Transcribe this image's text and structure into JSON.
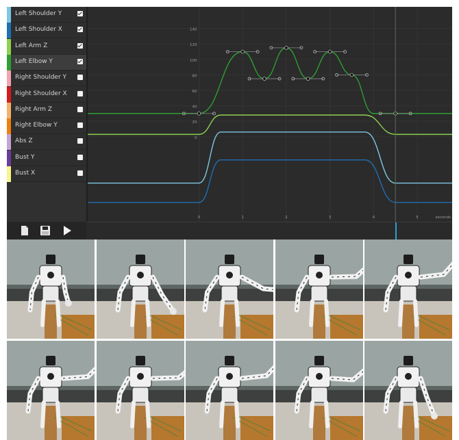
{
  "tracks": [
    {
      "label": "Left Shoulder Y",
      "color": "#7ec8e3",
      "checked": true,
      "selected": false
    },
    {
      "label": "Left Shoulder X",
      "color": "#1f6fb5",
      "checked": true,
      "selected": false
    },
    {
      "label": "Left Arm Z",
      "color": "#8fd14f",
      "checked": true,
      "selected": false
    },
    {
      "label": "Left Elbow Y",
      "color": "#2f9e33",
      "checked": true,
      "selected": true
    },
    {
      "label": "Right Shoulder Y",
      "color": "#f4a3b0",
      "checked": false,
      "selected": false
    },
    {
      "label": "Right Shoulder X",
      "color": "#d7191c",
      "checked": false,
      "selected": false
    },
    {
      "label": "Right Arm Z",
      "color": "#f4b26b",
      "checked": false,
      "selected": false
    },
    {
      "label": "Right Elbow Y",
      "color": "#f07f0f",
      "checked": false,
      "selected": false
    },
    {
      "label": "Abs Z",
      "color": "#c2a5d6",
      "checked": false,
      "selected": false
    },
    {
      "label": "Bust Y",
      "color": "#6a3d9a",
      "checked": false,
      "selected": false
    },
    {
      "label": "Bust X",
      "color": "#f7f58c",
      "checked": false,
      "selected": false
    }
  ],
  "toolbar": {
    "new_icon": "document-icon",
    "save_icon": "save-disk-icon",
    "play_icon": "play-icon"
  },
  "chart_data": {
    "type": "line",
    "xlabel": "seconds",
    "x_ticks": [
      0,
      1,
      2,
      3,
      4,
      5
    ],
    "y_ticks": [
      0,
      20,
      40,
      60,
      80,
      100,
      120,
      140
    ],
    "xlim": [
      -2.55,
      5.8
    ],
    "ylim": [
      -110,
      168
    ],
    "cursor_x": 4.5,
    "series": [
      {
        "color": "#2f9e33",
        "points": [
          [
            -2.55,
            30
          ],
          [
            0,
            30
          ],
          [
            1,
            110
          ],
          [
            1.5,
            75
          ],
          [
            2,
            115
          ],
          [
            2.5,
            75
          ],
          [
            3,
            110
          ],
          [
            3.5,
            80
          ],
          [
            4,
            30
          ],
          [
            4.5,
            30
          ],
          [
            5.8,
            30
          ]
        ],
        "keyframes": [
          [
            0,
            30
          ],
          [
            1,
            110
          ],
          [
            1.5,
            75
          ],
          [
            2,
            115
          ],
          [
            2.5,
            75
          ],
          [
            3,
            110
          ],
          [
            3.5,
            80
          ],
          [
            4.5,
            30
          ]
        ]
      },
      {
        "color": "#8fd14f",
        "points": [
          [
            -2.55,
            3
          ],
          [
            0,
            3
          ],
          [
            0.5,
            28
          ],
          [
            3.8,
            28
          ],
          [
            4.5,
            3
          ],
          [
            5.8,
            3
          ]
        ]
      },
      {
        "color": "#7ec8e3",
        "points": [
          [
            -2.55,
            -60
          ],
          [
            0,
            -60
          ],
          [
            0.5,
            6
          ],
          [
            3.8,
            6
          ],
          [
            4.5,
            -60
          ],
          [
            5.8,
            -60
          ]
        ]
      },
      {
        "color": "#1f6fb5",
        "points": [
          [
            -2.55,
            -85
          ],
          [
            0,
            -85
          ],
          [
            0.5,
            -30
          ],
          [
            3.8,
            -30
          ],
          [
            4.5,
            -85
          ],
          [
            5.8,
            -85
          ]
        ]
      }
    ]
  }
}
